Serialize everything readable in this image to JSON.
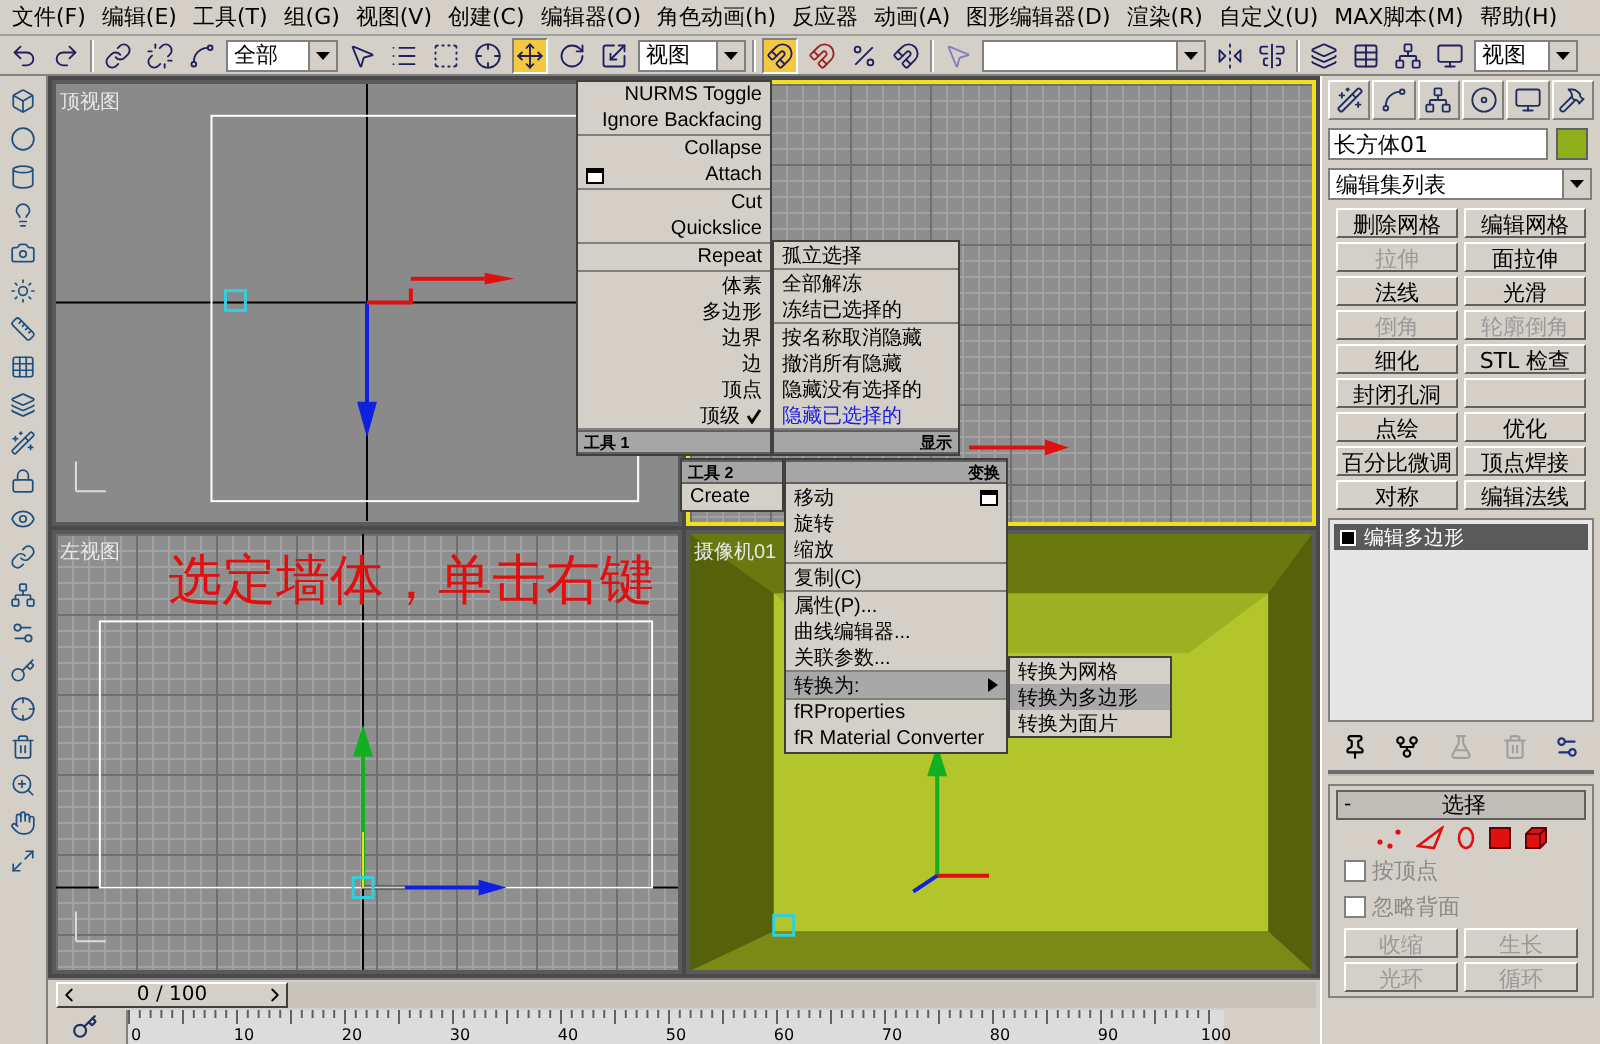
{
  "menu_bar": [
    "文件(F)",
    "编辑(E)",
    "工具(T)",
    "组(G)",
    "视图(V)",
    "创建(C)",
    "编辑器(O)",
    "角色动画(h)",
    "反应器",
    "动画(A)",
    "图形编辑器(D)",
    "渲染(R)",
    "自定义(U)",
    "MAX脚本(M)",
    "帮助(H)"
  ],
  "toolbar": {
    "selection_filter": "全部",
    "reference_coordinate": "视图",
    "render_view": "视图"
  },
  "viewports": [
    {
      "kind": "top",
      "label": "顶视图",
      "active": false
    },
    {
      "kind": "perspective",
      "active": true
    },
    {
      "kind": "left",
      "label": "左视图",
      "active": false,
      "annotation": "选定墙体，单击右键"
    },
    {
      "kind": "camera",
      "label": "摄像机01",
      "active": false
    }
  ],
  "quad_menus": [
    {
      "title": "工具 1",
      "groups": [
        [
          {
            "label": "NURMS Toggle",
            "kind": "plain",
            "checked": false,
            "selected": false,
            "highlighted": false
          },
          {
            "label": "Ignore Backfacing",
            "kind": "plain",
            "checked": false,
            "selected": false,
            "highlighted": false
          }
        ],
        [
          {
            "label": "Collapse",
            "kind": "plain",
            "checked": false,
            "selected": false,
            "highlighted": false
          },
          {
            "label": "Attach",
            "kind": "icon",
            "checked": false,
            "selected": false,
            "highlighted": false
          }
        ],
        [
          {
            "label": "Cut",
            "kind": "plain",
            "checked": false,
            "selected": false,
            "highlighted": false
          },
          {
            "label": "Quickslice",
            "kind": "plain",
            "checked": false,
            "selected": false,
            "highlighted": false
          }
        ],
        [
          {
            "label": "Repeat",
            "kind": "plain",
            "checked": false,
            "selected": false,
            "highlighted": false
          }
        ],
        [
          {
            "label": "体素",
            "kind": "plain",
            "checked": false,
            "selected": false,
            "highlighted": false
          },
          {
            "label": "多边形",
            "kind": "plain",
            "checked": false,
            "selected": false,
            "highlighted": false
          },
          {
            "label": "边界",
            "kind": "plain",
            "checked": false,
            "selected": false,
            "highlighted": false
          },
          {
            "label": "边",
            "kind": "plain",
            "checked": false,
            "selected": false,
            "highlighted": false
          },
          {
            "label": "顶点",
            "kind": "plain",
            "checked": false,
            "selected": false,
            "highlighted": false
          },
          {
            "label": "顶级",
            "kind": "plain",
            "checked": true,
            "selected": false,
            "highlighted": false
          }
        ]
      ]
    },
    {
      "title": "显示",
      "groups": [
        [
          {
            "label": "孤立选择",
            "kind": "plain",
            "selected": false,
            "highlighted": false
          }
        ],
        [
          {
            "label": "全部解冻",
            "kind": "plain",
            "selected": false,
            "highlighted": false
          },
          {
            "label": "冻结已选择的",
            "kind": "plain",
            "selected": false,
            "highlighted": false
          }
        ],
        [
          {
            "label": "按名称取消隐藏",
            "kind": "plain",
            "selected": false,
            "highlighted": false
          },
          {
            "label": "撤消所有隐藏",
            "kind": "plain",
            "selected": false,
            "highlighted": false
          },
          {
            "label": "隐藏没有选择的",
            "kind": "plain",
            "selected": false,
            "highlighted": false
          },
          {
            "label": "隐藏已选择的",
            "kind": "plain",
            "selected": true,
            "highlighted": false
          }
        ]
      ]
    },
    {
      "title": "工具 2",
      "groups": [
        [
          {
            "label": "Create",
            "kind": "plain",
            "selected": false,
            "highlighted": false
          }
        ]
      ]
    },
    {
      "title": "变换",
      "groups": [
        [
          {
            "label": "移动",
            "kind": "icon",
            "selected": false,
            "highlighted": false
          },
          {
            "label": "旋转",
            "kind": "plain",
            "selected": false,
            "highlighted": false
          },
          {
            "label": "缩放",
            "kind": "plain",
            "selected": false,
            "highlighted": false
          }
        ],
        [
          {
            "label": "复制(C)",
            "kind": "plain",
            "selected": false,
            "highlighted": false
          }
        ],
        [
          {
            "label": "属性(P)...",
            "kind": "plain",
            "selected": false,
            "highlighted": false
          },
          {
            "label": "曲线编辑器...",
            "kind": "plain",
            "selected": false,
            "highlighted": false
          },
          {
            "label": "关联参数...",
            "kind": "plain",
            "selected": false,
            "highlighted": false
          }
        ],
        [
          {
            "label": "转换为:",
            "kind": "submenu",
            "selected": false,
            "highlighted": true
          }
        ],
        [
          {
            "label": "fRProperties",
            "kind": "plain",
            "selected": false,
            "highlighted": false
          },
          {
            "label": "fR Material Converter",
            "kind": "plain",
            "selected": false,
            "highlighted": false
          }
        ]
      ]
    },
    {
      "groups": [
        [
          {
            "label": "转换为网格",
            "kind": "plain",
            "selected": false,
            "highlighted": false
          },
          {
            "label": "转换为多边形",
            "kind": "plain",
            "selected": false,
            "highlighted": true
          },
          {
            "label": "转换为面片",
            "kind": "plain",
            "selected": false,
            "highlighted": false
          }
        ]
      ]
    }
  ],
  "command_panel": {
    "object_name": "长方体01",
    "modifier_list": "编辑集列表",
    "buttons": [
      {
        "kind": "button",
        "label": "删除网格",
        "disabled": false
      },
      {
        "kind": "button",
        "label": "编辑网格",
        "disabled": false
      },
      {
        "kind": "button",
        "label": "拉伸",
        "disabled": true
      },
      {
        "kind": "button",
        "label": "面拉伸",
        "disabled": false
      },
      {
        "kind": "button",
        "label": "法线",
        "disabled": false
      },
      {
        "kind": "button",
        "label": "光滑",
        "disabled": false
      },
      {
        "kind": "button",
        "label": "倒角",
        "disabled": true
      },
      {
        "kind": "button",
        "label": "轮廓倒角",
        "disabled": true
      },
      {
        "kind": "button",
        "label": "细化",
        "disabled": false
      },
      {
        "kind": "button",
        "label": "STL 检查",
        "disabled": false
      },
      {
        "kind": "button",
        "label": "封闭孔洞",
        "disabled": false
      },
      {
        "kind": "blank"
      },
      {
        "kind": "button",
        "label": "点绘",
        "disabled": false
      },
      {
        "kind": "button",
        "label": "优化",
        "disabled": false
      },
      {
        "kind": "button",
        "label": "百分比微调",
        "disabled": false
      },
      {
        "kind": "button",
        "label": "顶点焊接",
        "disabled": false
      },
      {
        "kind": "button",
        "label": "对称",
        "disabled": false
      },
      {
        "kind": "button",
        "label": "编辑法线",
        "disabled": false
      }
    ],
    "stack": [
      {
        "label": "编辑多边形",
        "selected": true
      }
    ],
    "rollout": {
      "toggle": "-",
      "title": "选择",
      "checkboxes": [
        {
          "label": "按顶点",
          "checked": false
        },
        {
          "label": "忽略背面",
          "checked": false
        }
      ],
      "buttons": [
        {
          "label": "收缩",
          "disabled": true
        },
        {
          "label": "生长",
          "disabled": true
        },
        {
          "label": "光环",
          "disabled": true
        },
        {
          "label": "循环",
          "disabled": true
        }
      ]
    }
  },
  "time_slider": {
    "frame": "0 / 100",
    "level": 0
  },
  "track_bar": {
    "ticks": [
      "0",
      "10",
      "20",
      "30",
      "40",
      "50",
      "60",
      "70",
      "80",
      "90",
      "100"
    ]
  }
}
